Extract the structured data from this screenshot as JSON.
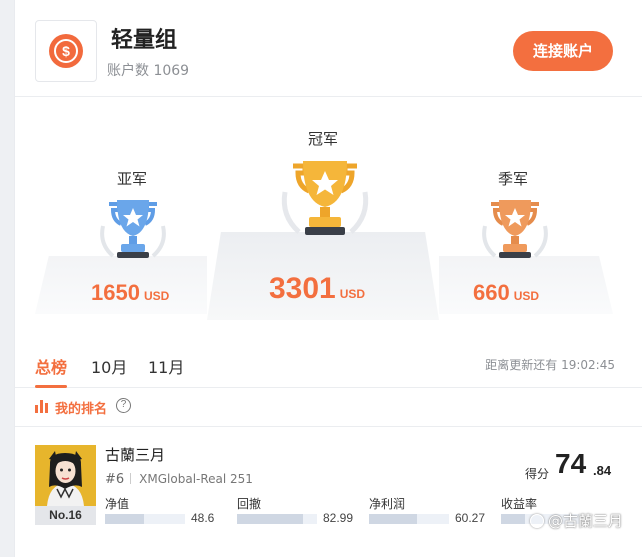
{
  "header": {
    "title": "轻量组",
    "account_count": "账户数 1069",
    "connect_button": "连接账户",
    "logo_icon": "dollar-coin-icon",
    "logo_symbol": "$",
    "accent": "#f36f3f"
  },
  "podium": {
    "second": {
      "label": "亚军",
      "amount": "1650",
      "unit": "USD",
      "trophy_color": "#6aa6ea"
    },
    "first": {
      "label": "冠军",
      "amount": "3301",
      "unit": "USD",
      "trophy_color": "#f5b63a"
    },
    "third": {
      "label": "季军",
      "amount": "660",
      "unit": "USD",
      "trophy_color": "#ef9a5c"
    }
  },
  "tabs": {
    "items": [
      {
        "label": "总榜",
        "active": true
      },
      {
        "label": "10月",
        "active": false
      },
      {
        "label": "11月",
        "active": false
      }
    ],
    "update_text": "距离更新还有 19:02:45"
  },
  "my_rank": {
    "label": "我的排名",
    "help_symbol": "?"
  },
  "row": {
    "rank_badge": "No.16",
    "name": "古蘭三月",
    "rank": "#6",
    "account": "XMGlobal-Real 251",
    "score_label": "得分",
    "score_int": "74",
    "score_dec": ".84",
    "metrics": [
      {
        "label": "净值",
        "value": "48.6",
        "fill": 0.49
      },
      {
        "label": "回撤",
        "value": "82.99",
        "fill": 0.83
      },
      {
        "label": "净利润",
        "value": "60.27",
        "fill": 0.6
      },
      {
        "label": "收益率",
        "value": "",
        "fill": 0.3
      }
    ]
  },
  "watermark": "@古蘭三月"
}
